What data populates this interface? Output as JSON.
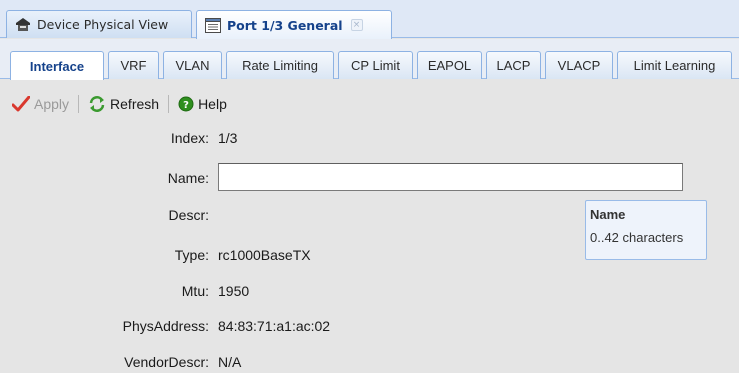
{
  "doc_tabs": [
    {
      "label": "Device Physical View",
      "icon": "device-icon",
      "active": false
    },
    {
      "label": "Port 1/3 General",
      "icon": "document-icon",
      "active": true,
      "close": "×"
    }
  ],
  "sub_tabs": [
    {
      "label": "Interface",
      "active": true
    },
    {
      "label": "VRF"
    },
    {
      "label": "VLAN"
    },
    {
      "label": "Rate Limiting"
    },
    {
      "label": "CP Limit"
    },
    {
      "label": "EAPOL"
    },
    {
      "label": "LACP"
    },
    {
      "label": "VLACP"
    },
    {
      "label": "Limit Learning"
    }
  ],
  "toolbar": {
    "apply_label": "Apply",
    "refresh_label": "Refresh",
    "help_label": "Help"
  },
  "form": {
    "index": {
      "label": "Index:",
      "value": "1/3"
    },
    "name": {
      "label": "Name:",
      "value": ""
    },
    "descr": {
      "label": "Descr:",
      "value": ""
    },
    "type": {
      "label": "Type:",
      "value": "rc1000BaseTX"
    },
    "mtu": {
      "label": "Mtu:",
      "value": "1950"
    },
    "physaddress": {
      "label": "PhysAddress:",
      "value": "84:83:71:a1:ac:02"
    },
    "vendordescr": {
      "label": "VendorDescr:",
      "value": "N/A"
    }
  },
  "tooltip": {
    "title": "Name",
    "text": "0..42 characters"
  },
  "colors": {
    "accent": "#15428b",
    "tab_border": "#8db2e3",
    "apply_check": "#d9382e",
    "refresh_green": "#3a9a2f",
    "help_green": "#2f8f1f"
  }
}
